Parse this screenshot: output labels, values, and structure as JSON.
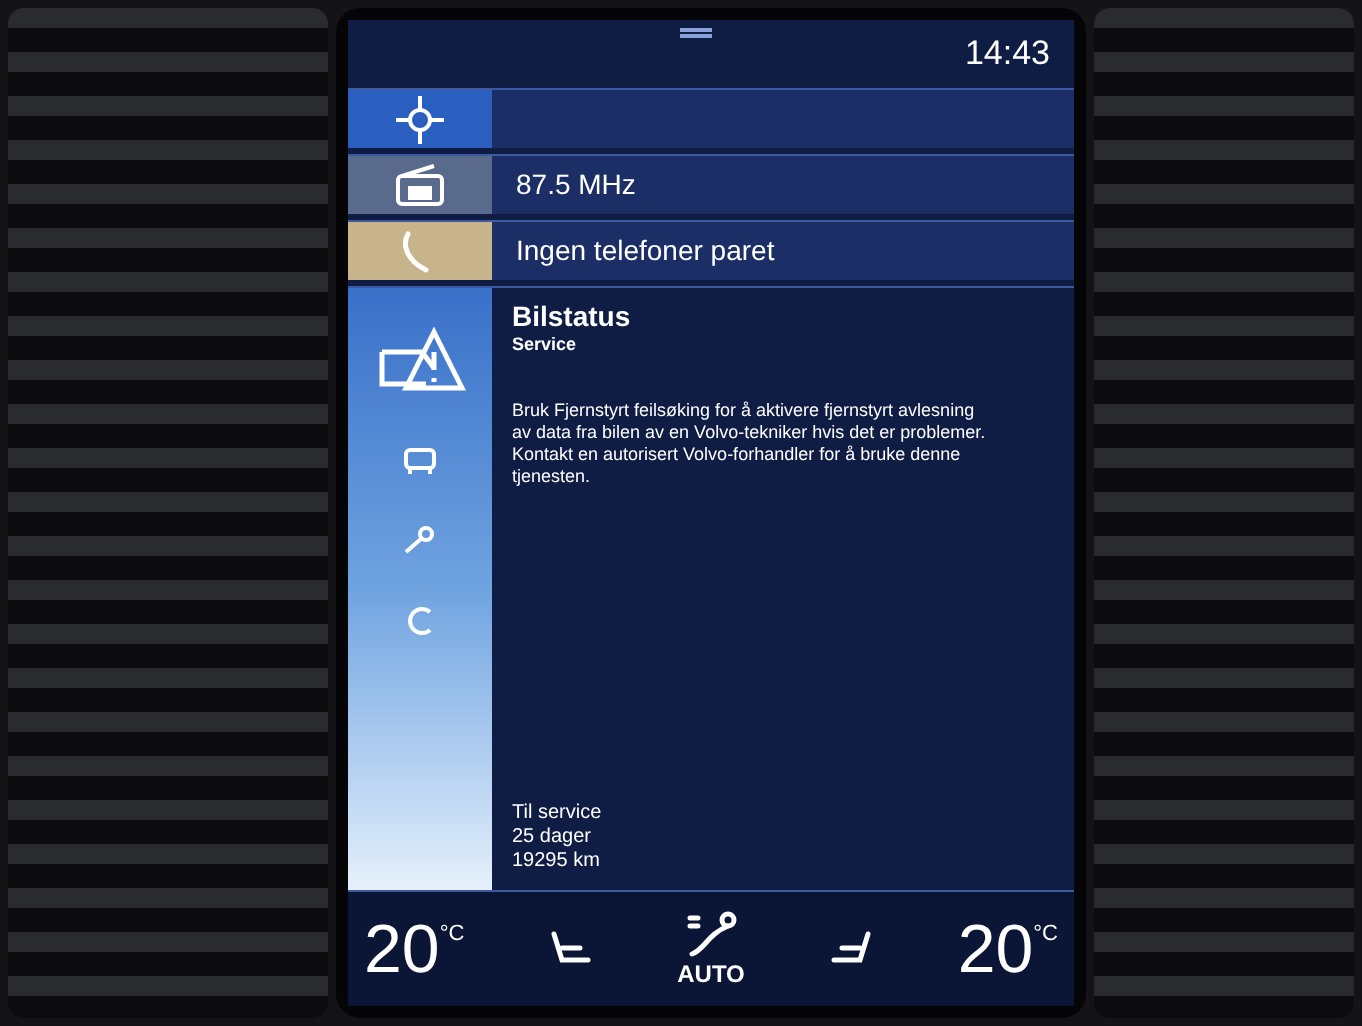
{
  "status_bar": {
    "time": "14:43"
  },
  "tiles": [
    {
      "kind": "navigation"
    },
    {
      "kind": "radio",
      "text": "87.5 MHz"
    },
    {
      "kind": "phone",
      "text": "Ingen telefoner paret"
    }
  ],
  "car_status": {
    "title": "Bilstatus",
    "subtitle": "Service",
    "message": "Bruk Fjernstyrt feilsøking for å aktivere fjernstyrt avlesning av data fra bilen av en Volvo-tekniker hvis det er problemer. Kontakt en autorisert Volvo-forhandler for å bruke denne tjenesten.",
    "service_lines": [
      "Til service",
      "25 dager",
      "19295 km"
    ]
  },
  "climate": {
    "left_temp": "20",
    "left_unit": "°C",
    "mode": "AUTO",
    "right_temp": "20",
    "right_unit": "°C"
  }
}
